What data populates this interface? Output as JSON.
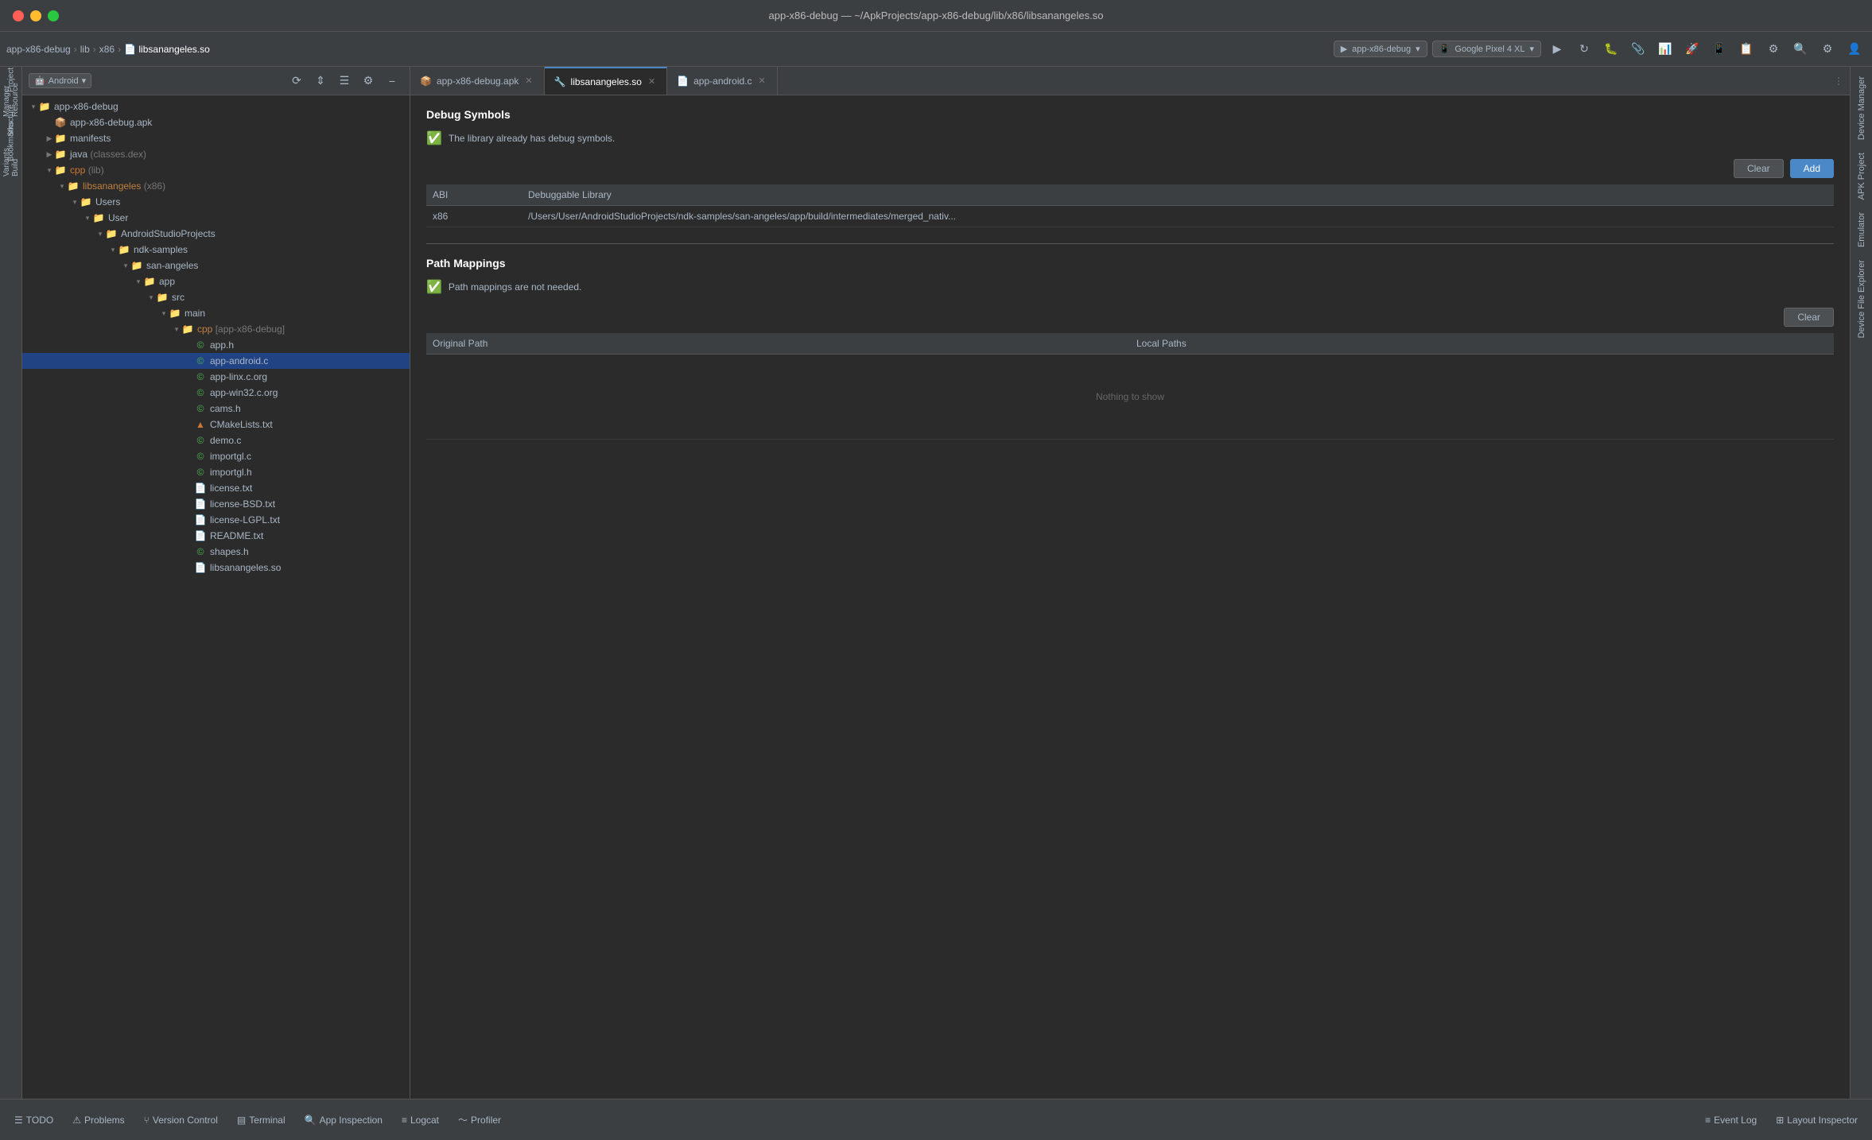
{
  "titleBar": {
    "title": "app-x86-debug — ~/ApkProjects/app-x86-debug/lib/x86/libsanangeles.so"
  },
  "breadcrumb": {
    "items": [
      "app-x86-debug",
      "lib",
      "x86",
      "libsanangeles.so"
    ]
  },
  "deviceSelector1": {
    "label": "app-x86-debug",
    "icon": "▶"
  },
  "deviceSelector2": {
    "label": "Google Pixel 4 XL",
    "icon": "📱"
  },
  "filePanel": {
    "selectorLabel": "Android",
    "rootItem": "app-x86-debug",
    "tree": [
      {
        "indent": 0,
        "type": "folder",
        "label": "app-x86-debug",
        "expanded": true
      },
      {
        "indent": 1,
        "type": "file",
        "label": "app-x86-debug.apk"
      },
      {
        "indent": 1,
        "type": "folder",
        "label": "manifests",
        "expanded": false
      },
      {
        "indent": 1,
        "type": "folder",
        "label": "java",
        "extra": "(classes.dex)",
        "expanded": false
      },
      {
        "indent": 1,
        "type": "cpp-folder",
        "label": "cpp",
        "extra": "(lib)",
        "expanded": true
      },
      {
        "indent": 2,
        "type": "cpp-folder",
        "label": "libsanangeles",
        "extra": "(x86)",
        "expanded": true
      },
      {
        "indent": 3,
        "type": "folder",
        "label": "Users",
        "expanded": true
      },
      {
        "indent": 4,
        "type": "folder",
        "label": "User",
        "expanded": true
      },
      {
        "indent": 5,
        "type": "folder",
        "label": "AndroidStudioProjects",
        "expanded": true
      },
      {
        "indent": 6,
        "type": "folder",
        "label": "ndk-samples",
        "expanded": true
      },
      {
        "indent": 7,
        "type": "folder",
        "label": "san-angeles",
        "expanded": true
      },
      {
        "indent": 8,
        "type": "folder",
        "label": "app",
        "expanded": true
      },
      {
        "indent": 9,
        "type": "folder",
        "label": "src",
        "expanded": true
      },
      {
        "indent": 10,
        "type": "folder",
        "label": "main",
        "expanded": true
      },
      {
        "indent": 11,
        "type": "cpp-folder",
        "label": "cpp",
        "extra": "[app-x86-debug]",
        "expanded": true
      },
      {
        "indent": 12,
        "type": "c-file",
        "label": "app.h"
      },
      {
        "indent": 12,
        "type": "c-file",
        "label": "app-android.c",
        "selected": true
      },
      {
        "indent": 12,
        "type": "c-file",
        "label": "app-linx.c.org"
      },
      {
        "indent": 12,
        "type": "c-file",
        "label": "app-win32.c.org"
      },
      {
        "indent": 12,
        "type": "c-file",
        "label": "cams.h"
      },
      {
        "indent": 12,
        "type": "cmake",
        "label": "CMakeLists.txt"
      },
      {
        "indent": 12,
        "type": "c-file",
        "label": "demo.c"
      },
      {
        "indent": 12,
        "type": "c-file",
        "label": "importgl.c"
      },
      {
        "indent": 12,
        "type": "c-file",
        "label": "importgl.h"
      },
      {
        "indent": 12,
        "type": "txt-file",
        "label": "license.txt"
      },
      {
        "indent": 12,
        "type": "txt-file",
        "label": "license-BSD.txt"
      },
      {
        "indent": 12,
        "type": "txt-file",
        "label": "license-LGPL.txt"
      },
      {
        "indent": 12,
        "type": "txt-file",
        "label": "README.txt"
      },
      {
        "indent": 12,
        "type": "c-file",
        "label": "shapes.h"
      },
      {
        "indent": 12,
        "type": "txt-file",
        "label": "libsanangeles.so"
      }
    ]
  },
  "tabs": [
    {
      "id": "apk",
      "label": "app-x86-debug.apk",
      "icon": "📦",
      "closable": true
    },
    {
      "id": "so",
      "label": "libsanangeles.so",
      "icon": "🔧",
      "closable": true,
      "active": true
    },
    {
      "id": "c",
      "label": "app-android.c",
      "icon": "📄",
      "closable": true
    }
  ],
  "debugSymbols": {
    "title": "Debug Symbols",
    "statusText": "The library already has debug symbols.",
    "clearLabel": "Clear",
    "addLabel": "Add",
    "tableHeaders": [
      "ABI",
      "Debuggable Library"
    ],
    "tableRows": [
      {
        "abi": "x86",
        "library": "/Users/User/AndroidStudioProjects/ndk-samples/san-angeles/app/build/intermediates/merged_nativ..."
      }
    ]
  },
  "pathMappings": {
    "title": "Path Mappings",
    "statusText": "Path mappings are not needed.",
    "clearLabel": "Clear",
    "tableHeaders": [
      "Original Path",
      "Local Paths"
    ],
    "nothingToShow": "Nothing to show"
  },
  "rightSidebar": {
    "items": [
      "Device Manager",
      "APK Project",
      "Emulator",
      "Device File Explorer"
    ]
  },
  "bottomBar": {
    "items": [
      {
        "id": "todo",
        "icon": "☰",
        "label": "TODO"
      },
      {
        "id": "problems",
        "icon": "⚠",
        "label": "Problems"
      },
      {
        "id": "vcs",
        "icon": "⑂",
        "label": "Version Control"
      },
      {
        "id": "terminal",
        "icon": "▤",
        "label": "Terminal"
      },
      {
        "id": "app-inspection",
        "icon": "🔍",
        "label": "App Inspection"
      },
      {
        "id": "logcat",
        "icon": "≡",
        "label": "Logcat"
      },
      {
        "id": "profiler",
        "icon": "〜",
        "label": "Profiler"
      }
    ],
    "rightItems": [
      {
        "id": "event-log",
        "icon": "≡",
        "label": "Event Log"
      },
      {
        "id": "layout-inspector",
        "icon": "⊞",
        "label": "Layout Inspector"
      }
    ]
  }
}
